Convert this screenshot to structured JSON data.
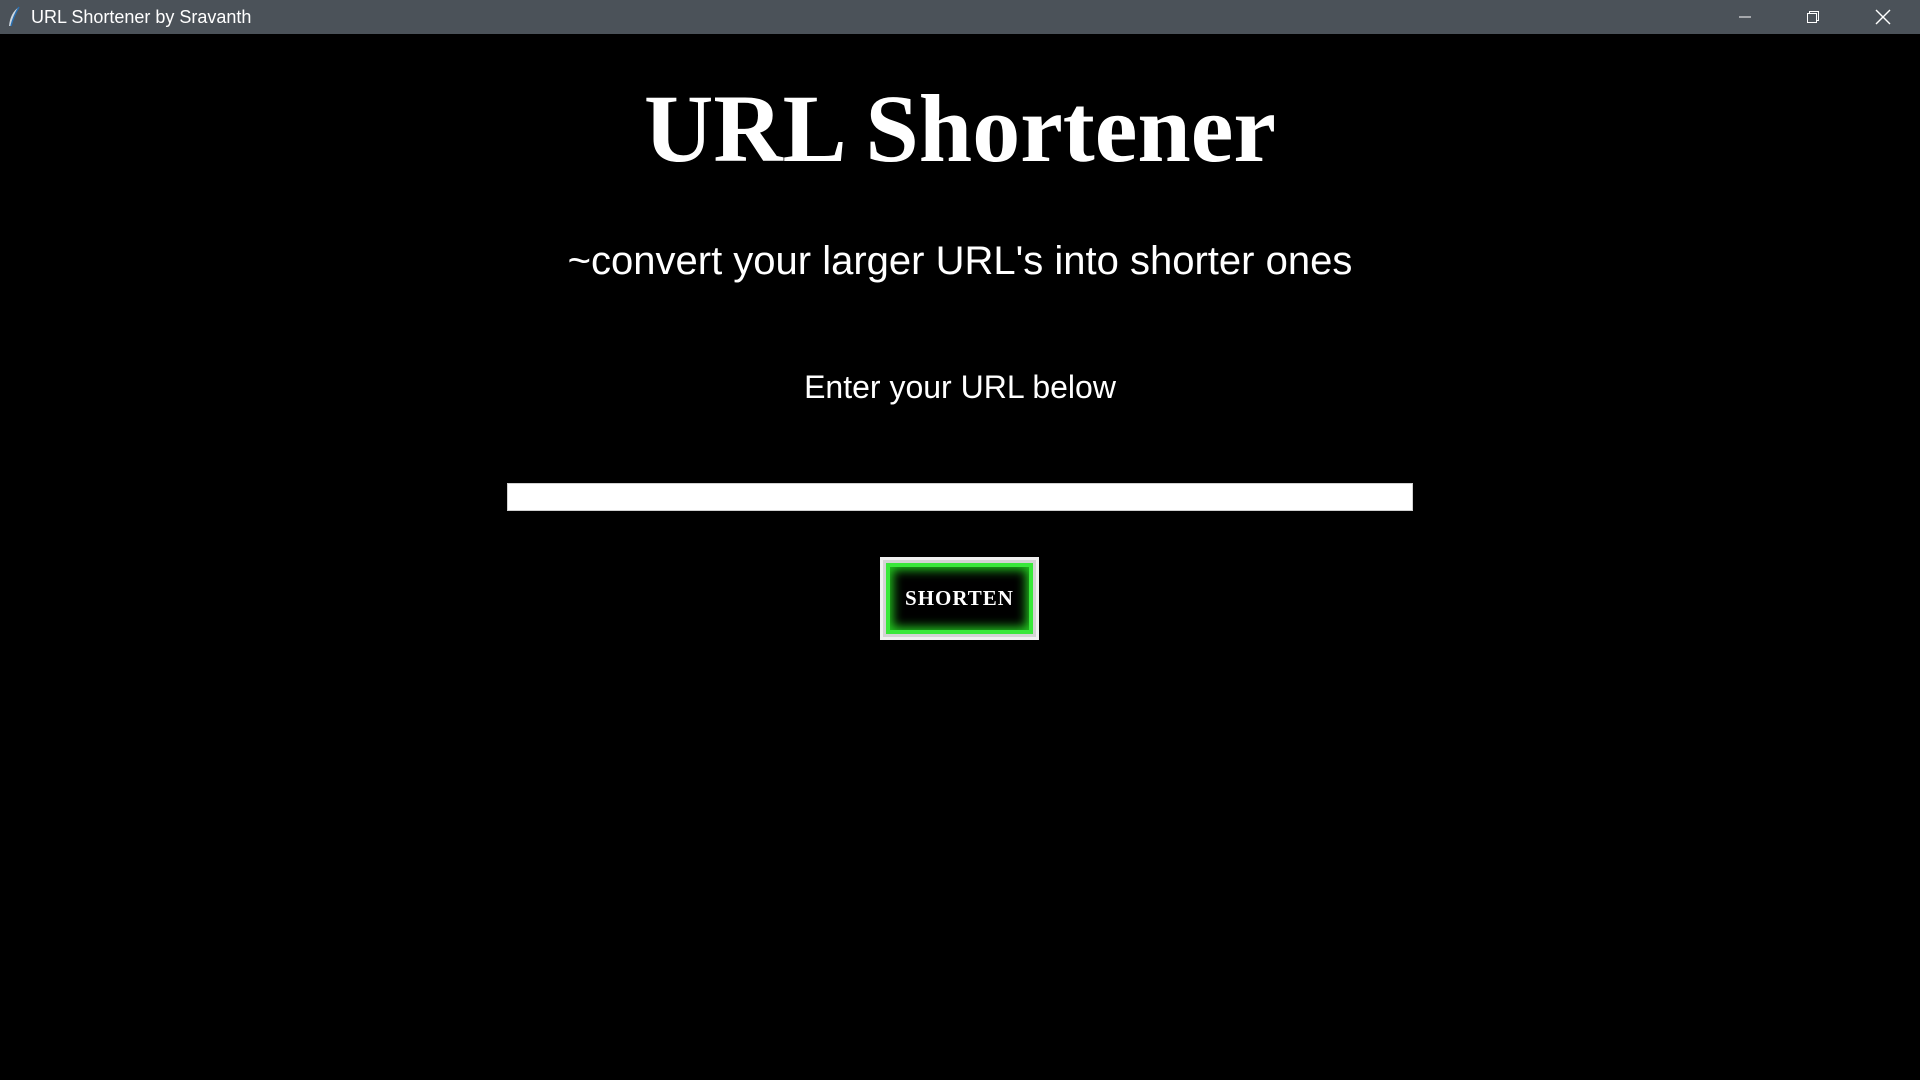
{
  "window": {
    "title": "URL Shortener by Sravanth",
    "icon": "feather-icon",
    "controls": {
      "minimize_icon": "minimize-icon",
      "maximize_icon": "restore-icon",
      "close_icon": "close-icon"
    }
  },
  "main": {
    "heading": "URL Shortener",
    "subtitle": "~convert your larger URL's into shorter ones",
    "prompt": "Enter your URL below",
    "url_input": {
      "value": "",
      "placeholder": ""
    },
    "shorten_button": {
      "label": "SHORTEN"
    }
  },
  "colors": {
    "background": "#000000",
    "titlebar": "#4b5259",
    "text": "#ffffff",
    "button_glow": "#39e83a"
  }
}
